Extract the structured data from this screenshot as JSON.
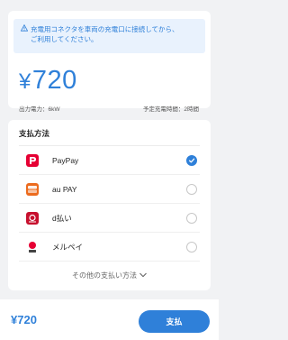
{
  "notice": {
    "line1": "充電用コネクタを車両の充電口に接続してから、",
    "line2": "ご利用してください。"
  },
  "charge": {
    "currency": "¥",
    "amount": "720",
    "output_label": "出力電力：6kW",
    "time_label": "予定充電時間：2時間"
  },
  "payment": {
    "title": "支払方法",
    "methods": [
      {
        "label": "PayPay",
        "selected": true
      },
      {
        "label": "au PAY",
        "selected": false
      },
      {
        "label": "d払い",
        "selected": false
      },
      {
        "label": "メルペイ",
        "selected": false
      }
    ],
    "more_label": "その他の支払い方法"
  },
  "footer": {
    "total": "¥720",
    "pay_button": "支払"
  },
  "colors": {
    "accent": "#2f80d9",
    "paypay_red": "#e60033",
    "aupay_orange": "#ec6b1e",
    "dpay_red": "#c7102e"
  }
}
